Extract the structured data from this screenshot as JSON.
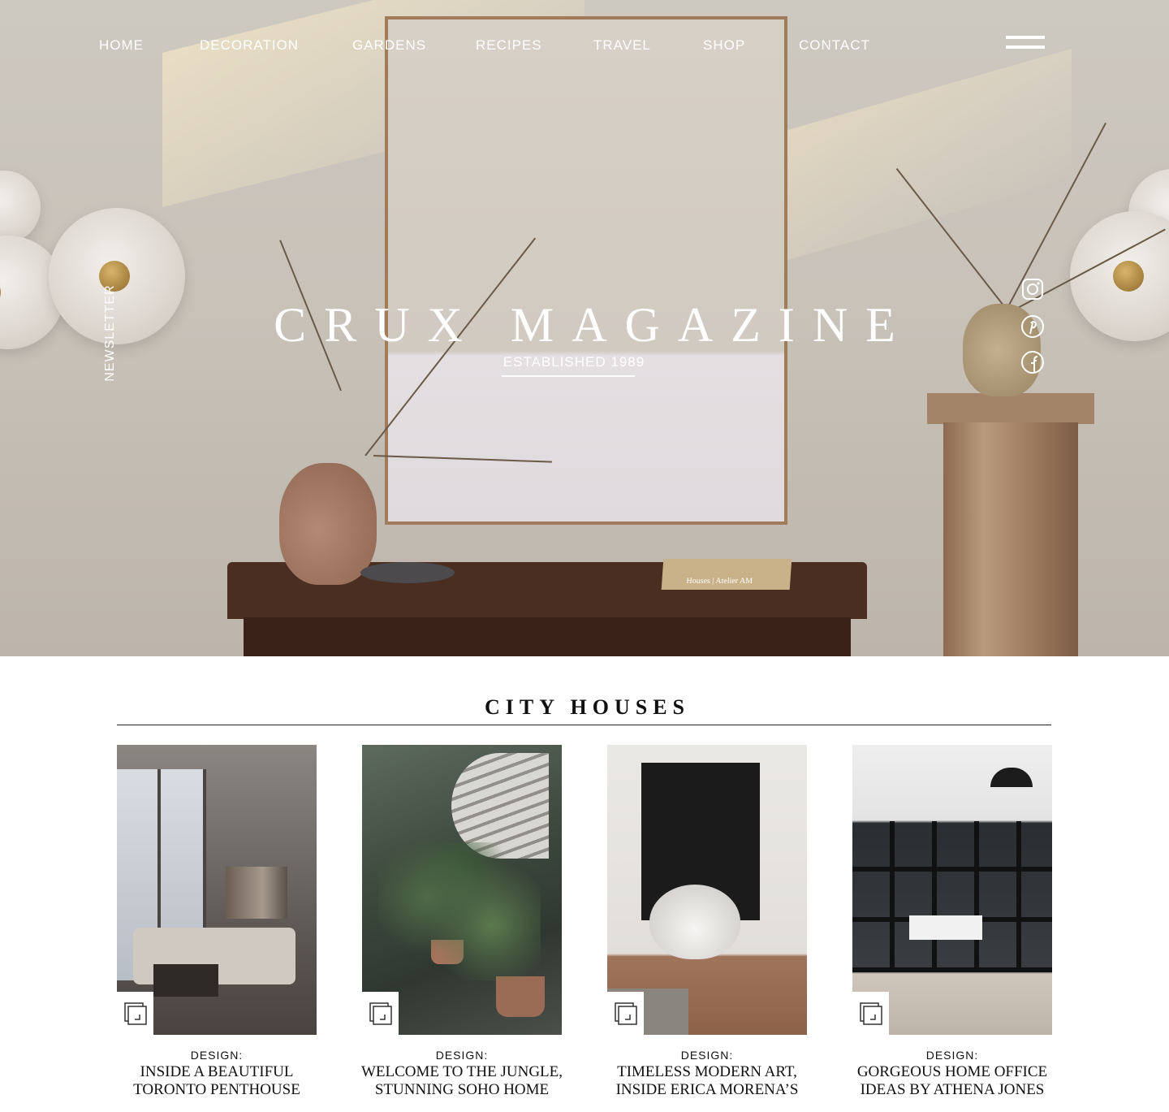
{
  "nav": {
    "items": [
      "HOME",
      "DECORATION",
      "GARDENS",
      "RECIPES",
      "TRAVEL",
      "SHOP",
      "CONTACT"
    ]
  },
  "hero": {
    "title": "CRUX MAGAZINE",
    "subtitle": "ESTABLISHED 1989",
    "newsletter": "NEWSLETTER",
    "book_label": "Houses | Atelier AM"
  },
  "social": [
    "instagram-icon",
    "pinterest-icon",
    "facebook-icon"
  ],
  "section": {
    "title": "CITY HOUSES",
    "cards": [
      {
        "category": "DESIGN:",
        "headline_1": "INSIDE A BEAUTIFUL",
        "headline_2": "TORONTO PENTHOUSE"
      },
      {
        "category": "DESIGN:",
        "headline_1": "WELCOME TO THE JUNGLE,",
        "headline_2": "STUNNING SOHO HOME"
      },
      {
        "category": "DESIGN:",
        "headline_1": "TIMELESS MODERN ART,",
        "headline_2": "INSIDE ERICA MORENA’S"
      },
      {
        "category": "DESIGN:",
        "headline_1": "GORGEOUS HOME OFFICE",
        "headline_2": "IDEAS BY ATHENA JONES"
      }
    ]
  },
  "colors": {
    "text_dark": "#111111",
    "hero_text": "#ffffff",
    "background": "#ffffff"
  }
}
